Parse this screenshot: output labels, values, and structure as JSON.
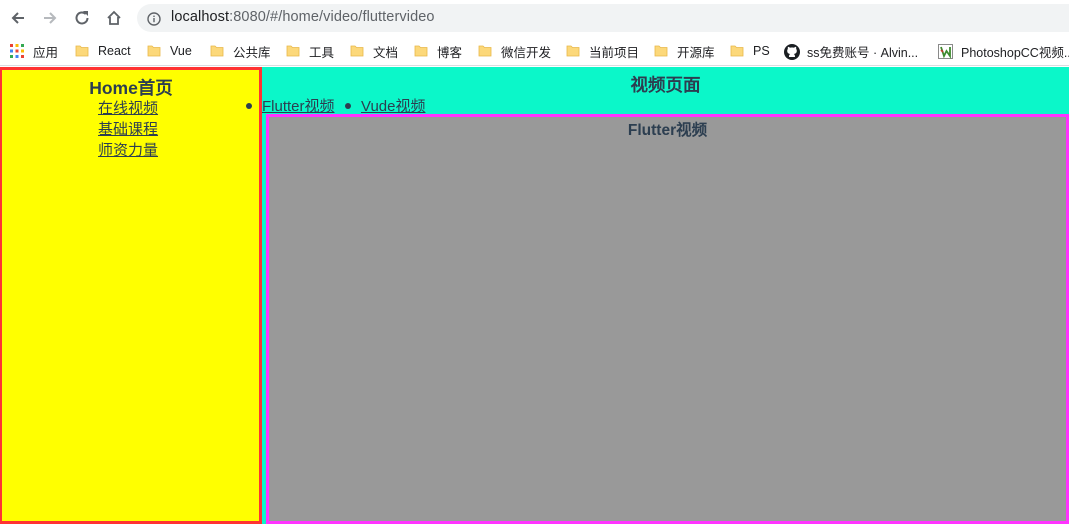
{
  "browser": {
    "url_host": "localhost",
    "url_rest": ":8080/#/home/video/fluttervideo",
    "bookmarks": [
      {
        "label": "应用",
        "icon": "apps-grid-icon"
      },
      {
        "label": "React",
        "icon": "folder-icon"
      },
      {
        "label": "Vue",
        "icon": "folder-icon"
      },
      {
        "label": "公共库",
        "icon": "folder-icon"
      },
      {
        "label": "工具",
        "icon": "folder-icon"
      },
      {
        "label": "文档",
        "icon": "folder-icon"
      },
      {
        "label": "博客",
        "icon": "folder-icon"
      },
      {
        "label": "微信开发",
        "icon": "folder-icon"
      },
      {
        "label": "当前项目",
        "icon": "folder-icon"
      },
      {
        "label": "开源库",
        "icon": "folder-icon"
      },
      {
        "label": "PS",
        "icon": "folder-icon"
      },
      {
        "label": "ss免费账号 · Alvin...",
        "icon": "github-icon"
      },
      {
        "label": "PhotoshopCC视频...",
        "icon": "photoshop-icon"
      }
    ]
  },
  "home": {
    "title": "Home首页",
    "nav": [
      {
        "label": "在线视频"
      },
      {
        "label": "基础课程"
      },
      {
        "label": "师资力量"
      }
    ]
  },
  "video_page": {
    "title": "视频页面",
    "tabs": [
      {
        "label": "Flutter视频"
      },
      {
        "label": "Vude视频"
      }
    ],
    "content_title": "Flutter视频"
  },
  "colors": {
    "left_bg": "#ffff00",
    "left_border": "#ff3333",
    "right_bg": "#0bf7c9",
    "video_bg": "#999999",
    "video_border": "#ff33ff",
    "text": "#2c3e50"
  }
}
